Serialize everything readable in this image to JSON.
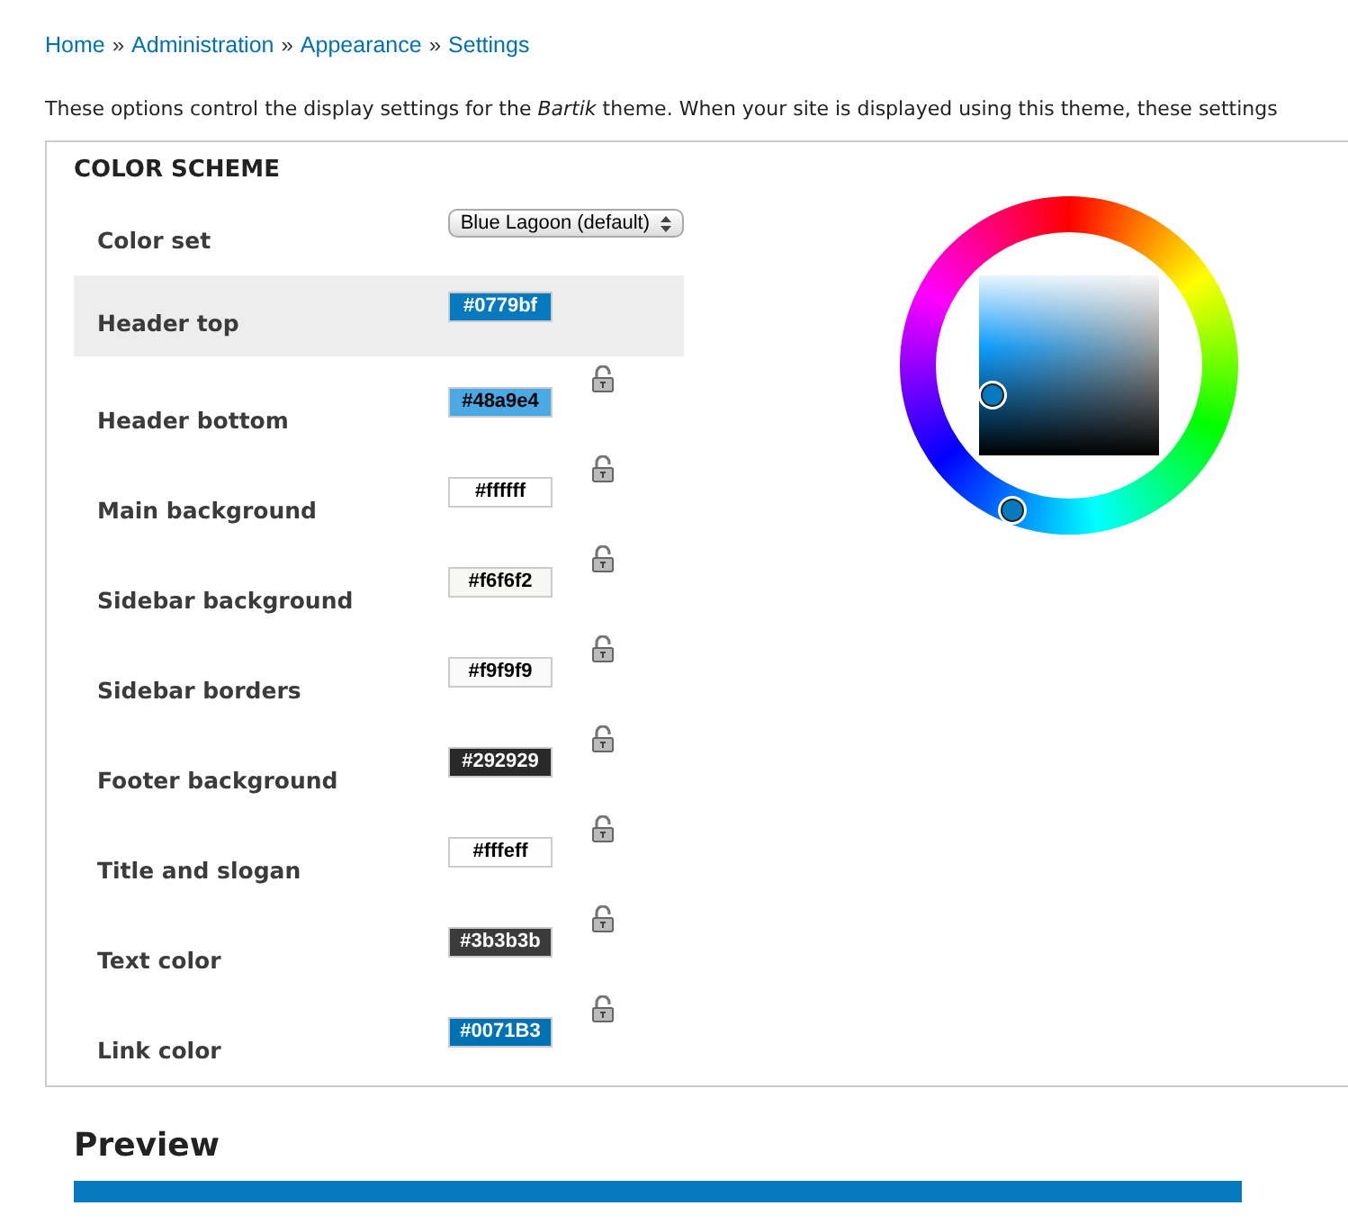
{
  "breadcrumb": {
    "separator": "»",
    "items": [
      {
        "label": "Home"
      },
      {
        "label": "Administration"
      },
      {
        "label": "Appearance"
      },
      {
        "label": "Settings"
      }
    ]
  },
  "description": "These options control the display settings for the *Bartik* theme. When your site is displayed using this theme, these settings",
  "color_scheme": {
    "legend": "COLOR SCHEME",
    "color_set": {
      "label": "Color set",
      "value": "Blue Lagoon (default)"
    },
    "fields": [
      {
        "label": "Header top",
        "value": "#0779bf",
        "color": "#0779bf",
        "selected": true
      },
      {
        "label": "Header bottom",
        "value": "#48a9e4",
        "color": "#48a9e4",
        "selected": false
      },
      {
        "label": "Main background",
        "value": "#ffffff",
        "color": "#ffffff",
        "selected": false
      },
      {
        "label": "Sidebar background",
        "value": "#f6f6f2",
        "color": "#f6f6f2",
        "selected": false
      },
      {
        "label": "Sidebar borders",
        "value": "#f9f9f9",
        "color": "#f9f9f9",
        "selected": false
      },
      {
        "label": "Footer background",
        "value": "#292929",
        "color": "#292929",
        "selected": false
      },
      {
        "label": "Title and slogan",
        "value": "#fffeff",
        "color": "#fffeff",
        "selected": false
      },
      {
        "label": "Text color",
        "value": "#3b3b3b",
        "color": "#3b3b3b",
        "selected": false
      },
      {
        "label": "Link color",
        "value": "#0071B3",
        "color": "#0071b3",
        "selected": false
      }
    ]
  },
  "preview": {
    "heading": "Preview"
  }
}
